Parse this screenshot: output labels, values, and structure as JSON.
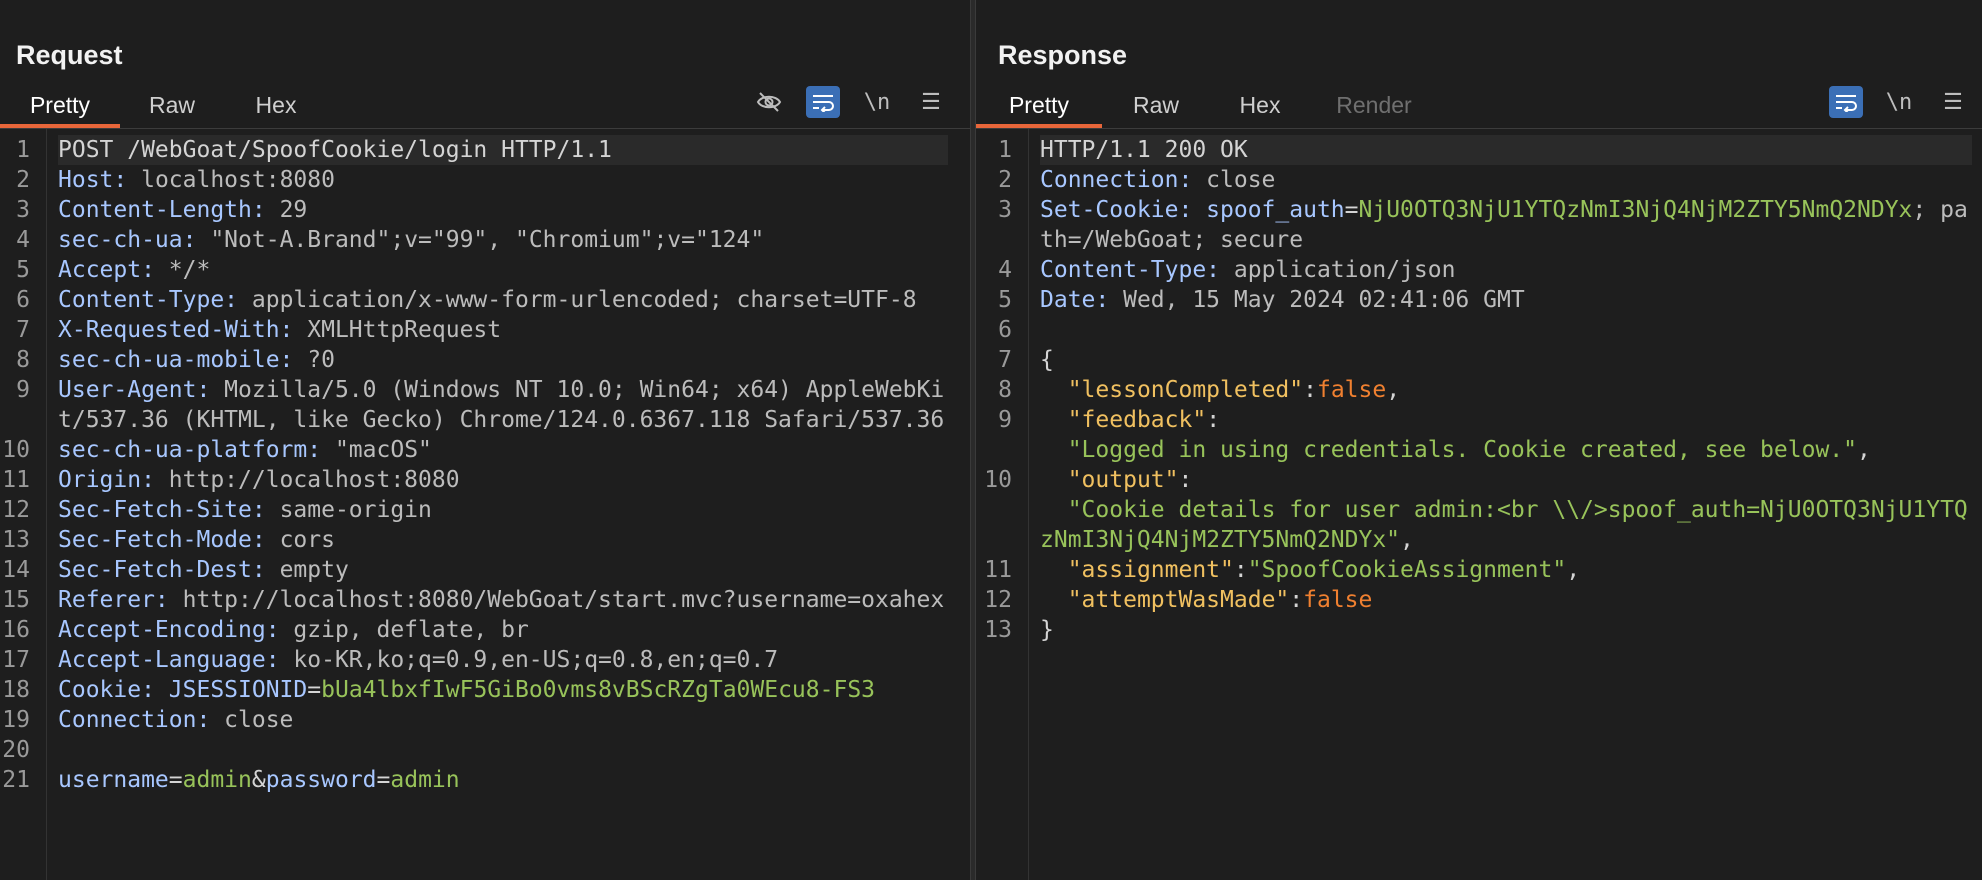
{
  "layout_buttons": [
    {
      "name": "side-by-side-layout-icon"
    },
    {
      "name": "stacked-layout-icon"
    },
    {
      "name": "single-layout-icon"
    }
  ],
  "request": {
    "title": "Request",
    "tabs": [
      "Pretty",
      "Raw",
      "Hex"
    ],
    "active_tab": "Pretty",
    "tools": {
      "hide_icon": "eye-slash-icon",
      "wrap_icon": "word-wrap-icon",
      "newline": "\\n",
      "menu": "☰"
    },
    "lines": [
      {
        "n": "1",
        "parts": [
          [
            "punc",
            "POST /WebGoat/SpoofCookie/login HTTP/1.1"
          ]
        ]
      },
      {
        "n": "2",
        "parts": [
          [
            "hk",
            "Host: "
          ],
          [
            "hv",
            "localhost:8080"
          ]
        ]
      },
      {
        "n": "3",
        "parts": [
          [
            "hk",
            "Content-Length: "
          ],
          [
            "hv",
            "29"
          ]
        ]
      },
      {
        "n": "4",
        "parts": [
          [
            "hk",
            "sec-ch-ua: "
          ],
          [
            "hv",
            "\"Not-A.Brand\";v=\"99\", \"Chromium\";v=\"124\""
          ]
        ]
      },
      {
        "n": "5",
        "parts": [
          [
            "hk",
            "Accept: "
          ],
          [
            "hv",
            "*/*"
          ]
        ]
      },
      {
        "n": "6",
        "parts": [
          [
            "hk",
            "Content-Type: "
          ],
          [
            "hv",
            "application/x-www-form-urlencoded; charset=UTF-8"
          ]
        ]
      },
      {
        "n": "7",
        "parts": [
          [
            "hk",
            "X-Requested-With: "
          ],
          [
            "hv",
            "XMLHttpRequest"
          ]
        ]
      },
      {
        "n": "8",
        "parts": [
          [
            "hk",
            "sec-ch-ua-mobile: "
          ],
          [
            "hv",
            "?0"
          ]
        ]
      },
      {
        "n": "9",
        "parts": [
          [
            "hk",
            "User-Agent: "
          ],
          [
            "hv",
            "Mozilla/5.0 (Windows NT 10.0; Win64; x64) AppleWebKit/537.36 (KHTML, like Gecko) Chrome/124.0.6367.118 Safari/537.36"
          ]
        ]
      },
      {
        "n": "10",
        "parts": [
          [
            "hk",
            "sec-ch-ua-platform: "
          ],
          [
            "hv",
            "\"macOS\""
          ]
        ]
      },
      {
        "n": "11",
        "parts": [
          [
            "hk",
            "Origin: "
          ],
          [
            "hv",
            "http://localhost:8080"
          ]
        ]
      },
      {
        "n": "12",
        "parts": [
          [
            "hk",
            "Sec-Fetch-Site: "
          ],
          [
            "hv",
            "same-origin"
          ]
        ]
      },
      {
        "n": "13",
        "parts": [
          [
            "hk",
            "Sec-Fetch-Mode: "
          ],
          [
            "hv",
            "cors"
          ]
        ]
      },
      {
        "n": "14",
        "parts": [
          [
            "hk",
            "Sec-Fetch-Dest: "
          ],
          [
            "hv",
            "empty"
          ]
        ]
      },
      {
        "n": "15",
        "parts": [
          [
            "hk",
            "Referer: "
          ],
          [
            "hv",
            "http://localhost:8080/WebGoat/start.mvc?username=oxahex"
          ]
        ]
      },
      {
        "n": "16",
        "parts": [
          [
            "hk",
            "Accept-Encoding: "
          ],
          [
            "hv",
            "gzip, deflate, br"
          ]
        ]
      },
      {
        "n": "17",
        "parts": [
          [
            "hk",
            "Accept-Language: "
          ],
          [
            "hv",
            "ko-KR,ko;q=0.9,en-US;q=0.8,en;q=0.7"
          ]
        ]
      },
      {
        "n": "18",
        "parts": [
          [
            "hk",
            "Cookie: "
          ],
          [
            "pk",
            "JSESSIONID"
          ],
          [
            "punc",
            "="
          ],
          [
            "pv",
            "bUa4lbxfIwF5GiBo0vms8vBScRZgTa0WEcu8-FS3"
          ]
        ]
      },
      {
        "n": "19",
        "parts": [
          [
            "hk",
            "Connection: "
          ],
          [
            "hv",
            "close"
          ]
        ]
      },
      {
        "n": "20",
        "parts": [
          [
            "punc",
            ""
          ]
        ]
      },
      {
        "n": "21",
        "parts": [
          [
            "pk",
            "username"
          ],
          [
            "punc",
            "="
          ],
          [
            "pv",
            "admin"
          ],
          [
            "punc",
            "&"
          ],
          [
            "pk",
            "password"
          ],
          [
            "punc",
            "="
          ],
          [
            "pv",
            "admin"
          ]
        ]
      }
    ]
  },
  "response": {
    "title": "Response",
    "tabs": [
      "Pretty",
      "Raw",
      "Hex",
      "Render"
    ],
    "active_tab": "Pretty",
    "tools": {
      "wrap_icon": "word-wrap-icon",
      "newline": "\\n",
      "menu": "☰"
    },
    "lines": [
      {
        "n": "1",
        "parts": [
          [
            "punc",
            "HTTP/1.1 200 OK"
          ]
        ]
      },
      {
        "n": "2",
        "parts": [
          [
            "hk",
            "Connection: "
          ],
          [
            "hv",
            "close"
          ]
        ]
      },
      {
        "n": "3",
        "parts": [
          [
            "hk",
            "Set-Cookie: "
          ],
          [
            "pk",
            "spoof_auth"
          ],
          [
            "punc",
            "="
          ],
          [
            "pv",
            "NjU0OTQ3NjU1YTQzNmI3NjQ4NjM2ZTY5NmQ2NDYx"
          ],
          [
            "hv",
            "; path=/WebGoat; secure"
          ]
        ]
      },
      {
        "n": "4",
        "parts": [
          [
            "hk",
            "Content-Type: "
          ],
          [
            "hv",
            "application/json"
          ]
        ]
      },
      {
        "n": "5",
        "parts": [
          [
            "hk",
            "Date: "
          ],
          [
            "hv",
            "Wed, 15 May 2024 02:41:06 GMT"
          ]
        ]
      },
      {
        "n": "6",
        "parts": [
          [
            "punc",
            ""
          ]
        ]
      },
      {
        "n": "7",
        "parts": [
          [
            "punc",
            "{"
          ]
        ]
      },
      {
        "n": "8",
        "parts": [
          [
            "punc",
            "  "
          ],
          [
            "jk",
            "\"lessonCompleted\""
          ],
          [
            "punc",
            ":"
          ],
          [
            "jb",
            "false"
          ],
          [
            "punc",
            ","
          ]
        ]
      },
      {
        "n": "9",
        "parts": [
          [
            "punc",
            "  "
          ],
          [
            "jk",
            "\"feedback\""
          ],
          [
            "punc",
            ":\n  "
          ],
          [
            "js",
            "\"Logged in using credentials. Cookie created, see below.\""
          ],
          [
            "punc",
            ","
          ]
        ]
      },
      {
        "n": "10",
        "parts": [
          [
            "punc",
            "  "
          ],
          [
            "jk",
            "\"output\""
          ],
          [
            "punc",
            ":\n  "
          ],
          [
            "js",
            "\"Cookie details for user admin:<br \\\\/>spoof_auth=NjU0OTQ3NjU1YTQzNmI3NjQ4NjM2ZTY5NmQ2NDYx\""
          ],
          [
            "punc",
            ","
          ]
        ]
      },
      {
        "n": "11",
        "parts": [
          [
            "punc",
            "  "
          ],
          [
            "jk",
            "\"assignment\""
          ],
          [
            "punc",
            ":"
          ],
          [
            "js",
            "\"SpoofCookieAssignment\""
          ],
          [
            "punc",
            ","
          ]
        ]
      },
      {
        "n": "12",
        "parts": [
          [
            "punc",
            "  "
          ],
          [
            "jk",
            "\"attemptWasMade\""
          ],
          [
            "punc",
            ":"
          ],
          [
            "jb",
            "false"
          ]
        ]
      },
      {
        "n": "13",
        "parts": [
          [
            "punc",
            "}"
          ]
        ]
      }
    ]
  }
}
